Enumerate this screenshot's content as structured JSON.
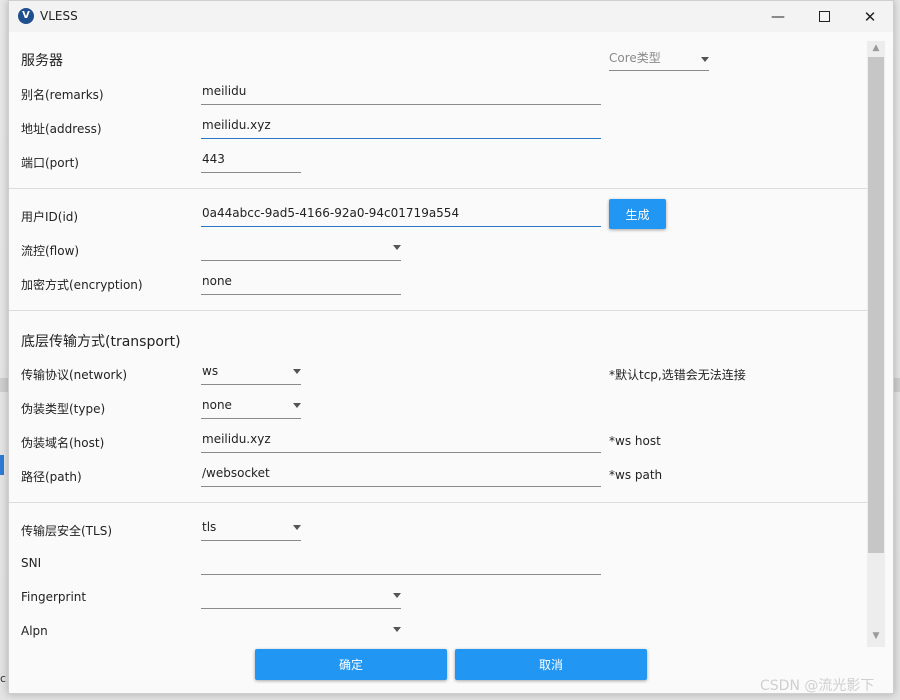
{
  "window": {
    "title": "VLESS",
    "logo_letter": "V"
  },
  "server": {
    "section_title": "服务器",
    "core_type_placeholder": "Core类型",
    "remarks": {
      "label": "别名(remarks)",
      "value": "meilidu"
    },
    "address": {
      "label": "地址(address)",
      "value": "meilidu.xyz"
    },
    "port": {
      "label": "端口(port)",
      "value": "443"
    }
  },
  "user": {
    "id": {
      "label": "用户ID(id)",
      "value": "0a44abcc-9ad5-4166-92a0-94c01719a554"
    },
    "generate_label": "生成",
    "flow": {
      "label": "流控(flow)",
      "value": ""
    },
    "encryption": {
      "label": "加密方式(encryption)",
      "value": "none"
    }
  },
  "transport": {
    "section_title": "底层传输方式(transport)",
    "network": {
      "label": "传输协议(network)",
      "value": "ws",
      "note": "*默认tcp,选错会无法连接"
    },
    "type": {
      "label": "伪装类型(type)",
      "value": "none"
    },
    "host": {
      "label": "伪装域名(host)",
      "value": "meilidu.xyz",
      "note": "*ws host"
    },
    "path": {
      "label": "路径(path)",
      "value": "/websocket",
      "note": "*ws path"
    }
  },
  "tls": {
    "security": {
      "label": "传输层安全(TLS)",
      "value": "tls"
    },
    "sni": {
      "label": "SNI",
      "value": ""
    },
    "fingerprint": {
      "label": "Fingerprint",
      "value": ""
    },
    "alpn": {
      "label": "Alpn",
      "value": ""
    }
  },
  "buttons": {
    "ok": "确定",
    "cancel": "取消"
  },
  "watermark": "CSDN @流光影下",
  "desktop_fragment": "c"
}
